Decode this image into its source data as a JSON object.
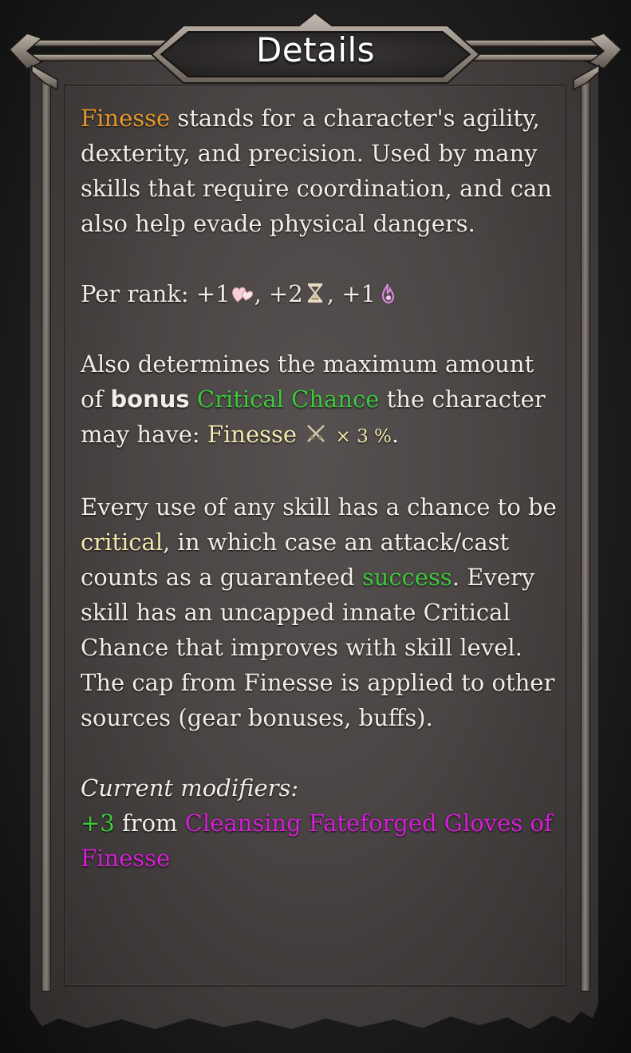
{
  "title": "Details",
  "intro": {
    "keyword": "Finesse",
    "text": " stands for a character's agility, dexterity, and precision. Used by many skills that require coordination, and can also help evade physical dangers."
  },
  "per_rank": {
    "label": "Per rank: ",
    "items": [
      {
        "value": "+1",
        "icon": "hearts-icon",
        "sep": ", "
      },
      {
        "value": "+2",
        "icon": "hourglass-icon",
        "sep": ", "
      },
      {
        "value": "+1",
        "icon": "flame-icon",
        "sep": ""
      }
    ]
  },
  "crit_cap": {
    "text1": "Also determines the maximum amount of ",
    "bonus": "bonus",
    "crit_chance": "Critical Chance",
    "text2": " the character may have: ",
    "formula_stat": "Finesse",
    "formula_icon": "crossed-swords-icon",
    "formula_mult": "× 3 %",
    "end": "."
  },
  "crit_explain": {
    "text1": "Every use of any skill has a chance to be ",
    "critical": "critical",
    "text2": ", in which case an attack/cast counts as a guaranteed ",
    "success": "success",
    "text3": ". Every skill has an uncapped innate Critical Chance that improves with skill level. The cap from Finesse is applied to other sources (gear bonuses, buffs)."
  },
  "modifiers": {
    "heading": "Current modifiers:",
    "value": "+3",
    "from": " from ",
    "source": "Cleansing Fateforged Gloves of Finesse"
  },
  "colors": {
    "keyword": "#e49a2c",
    "positive": "#3ec93e",
    "highlight": "#f3eab0",
    "item": "#d61fd6"
  }
}
